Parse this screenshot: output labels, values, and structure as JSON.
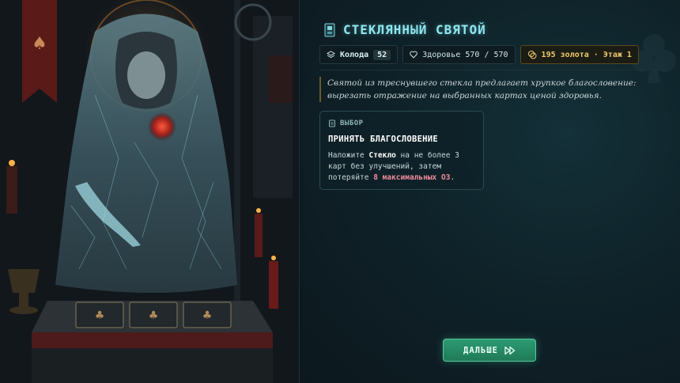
{
  "event": {
    "title": "СТЕКЛЯННЫЙ СВЯТОЙ",
    "title_icon": "stained-glass-icon"
  },
  "stats": {
    "deck_label": "Колода",
    "deck_count": "52",
    "health_text": "Здоровье 570 / 570",
    "gold_text": "195 золота · Этаж 1"
  },
  "description": "Святой из треснувшего стекла предлагает хрупкое благословение: вырезать отражение на выбранных картах ценой здоровья.",
  "choice": {
    "tag": "ВЫБОР",
    "title": "ПРИНЯТЬ БЛАГОСЛОВЕНИЕ",
    "desc_part1": "Наложите ",
    "desc_keyword": "Стекло",
    "desc_part2": " на не более 3 карт без улучшений, затем потеряйте ",
    "desc_cost": "8 максимальных ОЗ",
    "desc_part3": "."
  },
  "next_button": {
    "label": "ДАЛЬШЕ",
    "icon": "fast-forward-icon"
  },
  "colors": {
    "accent": "#8fe6ee",
    "gold": "#f0c96a",
    "cost_red": "#f08a9a",
    "button_green": "#2d9a72"
  }
}
